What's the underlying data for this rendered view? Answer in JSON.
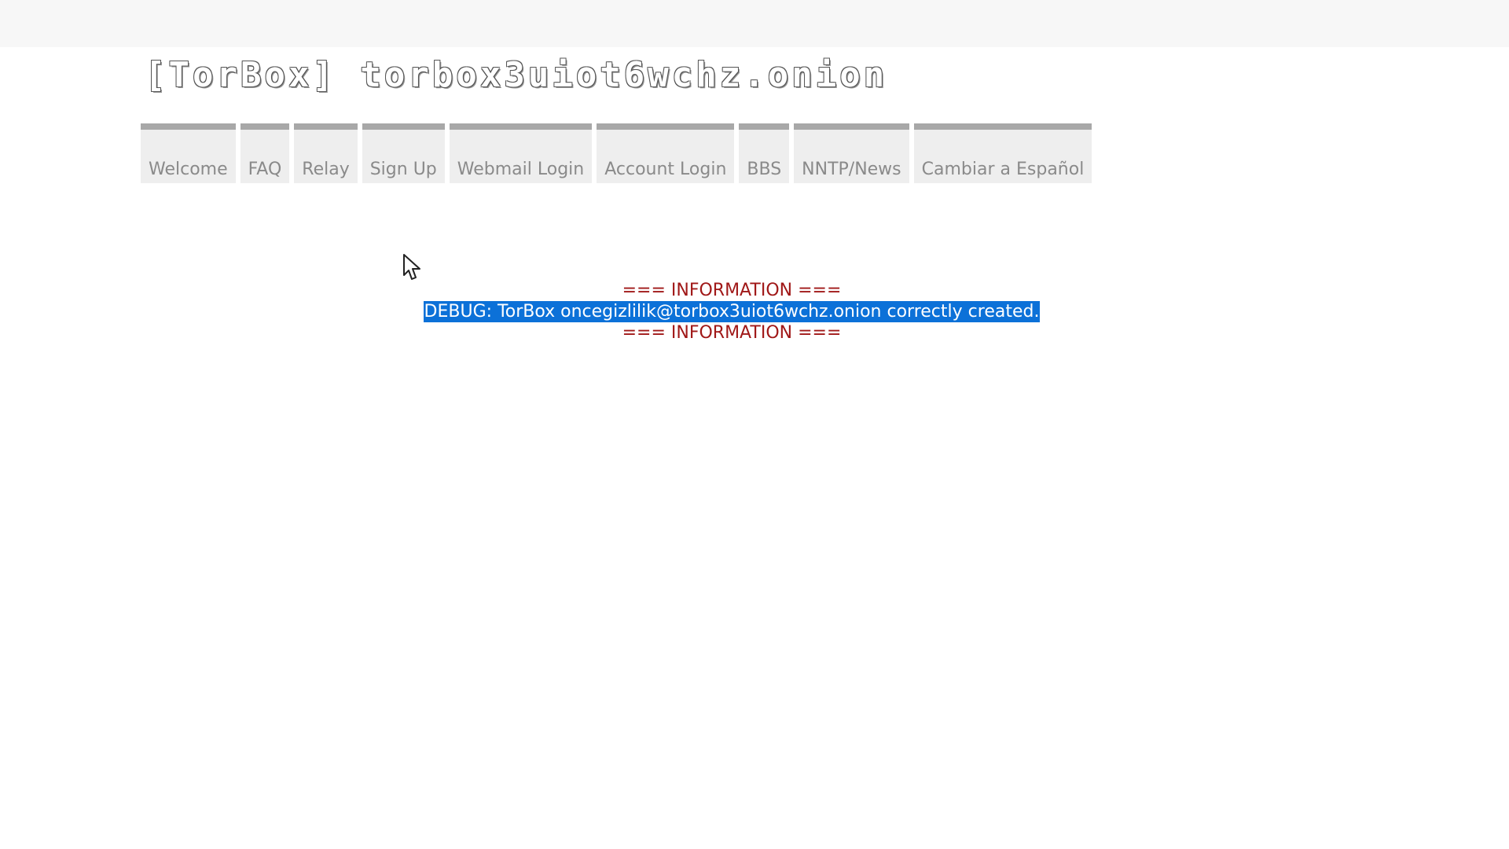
{
  "header": {
    "logo_text": "[TorBox] torbox3uiot6wchz.onion"
  },
  "nav": {
    "items": [
      {
        "label": "Welcome"
      },
      {
        "label": "FAQ"
      },
      {
        "label": "Relay"
      },
      {
        "label": "Sign Up"
      },
      {
        "label": "Webmail Login"
      },
      {
        "label": "Account Login"
      },
      {
        "label": "BBS"
      },
      {
        "label": "NNTP/News"
      },
      {
        "label": "Cambiar a Español"
      }
    ]
  },
  "message": {
    "header_line": "=== INFORMATION ===",
    "debug_text": "DEBUG: TorBox oncegizlilik@torbox3uiot6wchz.onion correctly created.",
    "footer_line": "=== INFORMATION ==="
  },
  "colors": {
    "info_text": "#a01818",
    "selection_highlight": "#0c71d8",
    "nav_background": "#eeeeee",
    "nav_top_border": "#a8a8a8"
  }
}
